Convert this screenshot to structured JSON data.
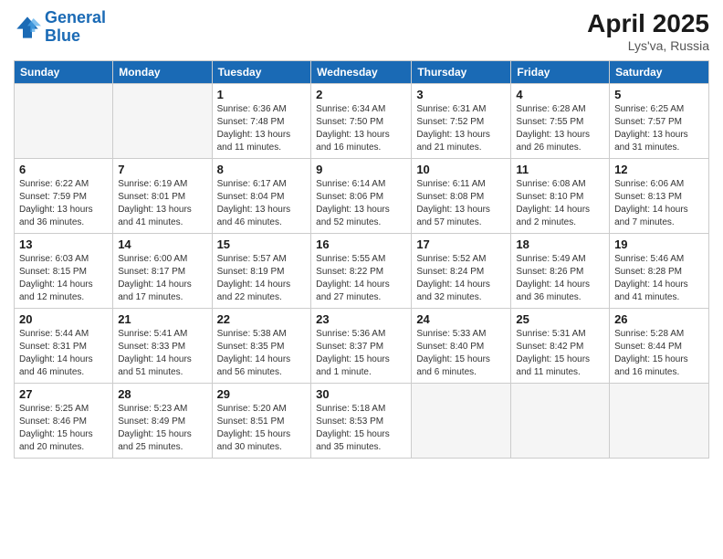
{
  "logo": {
    "line1": "General",
    "line2": "Blue"
  },
  "title": "April 2025",
  "subtitle": "Lys'va, Russia",
  "days_of_week": [
    "Sunday",
    "Monday",
    "Tuesday",
    "Wednesday",
    "Thursday",
    "Friday",
    "Saturday"
  ],
  "weeks": [
    [
      {
        "day": "",
        "empty": true
      },
      {
        "day": "",
        "empty": true
      },
      {
        "day": "1",
        "sunrise": "Sunrise: 6:36 AM",
        "sunset": "Sunset: 7:48 PM",
        "daylight": "Daylight: 13 hours and 11 minutes."
      },
      {
        "day": "2",
        "sunrise": "Sunrise: 6:34 AM",
        "sunset": "Sunset: 7:50 PM",
        "daylight": "Daylight: 13 hours and 16 minutes."
      },
      {
        "day": "3",
        "sunrise": "Sunrise: 6:31 AM",
        "sunset": "Sunset: 7:52 PM",
        "daylight": "Daylight: 13 hours and 21 minutes."
      },
      {
        "day": "4",
        "sunrise": "Sunrise: 6:28 AM",
        "sunset": "Sunset: 7:55 PM",
        "daylight": "Daylight: 13 hours and 26 minutes."
      },
      {
        "day": "5",
        "sunrise": "Sunrise: 6:25 AM",
        "sunset": "Sunset: 7:57 PM",
        "daylight": "Daylight: 13 hours and 31 minutes."
      }
    ],
    [
      {
        "day": "6",
        "sunrise": "Sunrise: 6:22 AM",
        "sunset": "Sunset: 7:59 PM",
        "daylight": "Daylight: 13 hours and 36 minutes."
      },
      {
        "day": "7",
        "sunrise": "Sunrise: 6:19 AM",
        "sunset": "Sunset: 8:01 PM",
        "daylight": "Daylight: 13 hours and 41 minutes."
      },
      {
        "day": "8",
        "sunrise": "Sunrise: 6:17 AM",
        "sunset": "Sunset: 8:04 PM",
        "daylight": "Daylight: 13 hours and 46 minutes."
      },
      {
        "day": "9",
        "sunrise": "Sunrise: 6:14 AM",
        "sunset": "Sunset: 8:06 PM",
        "daylight": "Daylight: 13 hours and 52 minutes."
      },
      {
        "day": "10",
        "sunrise": "Sunrise: 6:11 AM",
        "sunset": "Sunset: 8:08 PM",
        "daylight": "Daylight: 13 hours and 57 minutes."
      },
      {
        "day": "11",
        "sunrise": "Sunrise: 6:08 AM",
        "sunset": "Sunset: 8:10 PM",
        "daylight": "Daylight: 14 hours and 2 minutes."
      },
      {
        "day": "12",
        "sunrise": "Sunrise: 6:06 AM",
        "sunset": "Sunset: 8:13 PM",
        "daylight": "Daylight: 14 hours and 7 minutes."
      }
    ],
    [
      {
        "day": "13",
        "sunrise": "Sunrise: 6:03 AM",
        "sunset": "Sunset: 8:15 PM",
        "daylight": "Daylight: 14 hours and 12 minutes."
      },
      {
        "day": "14",
        "sunrise": "Sunrise: 6:00 AM",
        "sunset": "Sunset: 8:17 PM",
        "daylight": "Daylight: 14 hours and 17 minutes."
      },
      {
        "day": "15",
        "sunrise": "Sunrise: 5:57 AM",
        "sunset": "Sunset: 8:19 PM",
        "daylight": "Daylight: 14 hours and 22 minutes."
      },
      {
        "day": "16",
        "sunrise": "Sunrise: 5:55 AM",
        "sunset": "Sunset: 8:22 PM",
        "daylight": "Daylight: 14 hours and 27 minutes."
      },
      {
        "day": "17",
        "sunrise": "Sunrise: 5:52 AM",
        "sunset": "Sunset: 8:24 PM",
        "daylight": "Daylight: 14 hours and 32 minutes."
      },
      {
        "day": "18",
        "sunrise": "Sunrise: 5:49 AM",
        "sunset": "Sunset: 8:26 PM",
        "daylight": "Daylight: 14 hours and 36 minutes."
      },
      {
        "day": "19",
        "sunrise": "Sunrise: 5:46 AM",
        "sunset": "Sunset: 8:28 PM",
        "daylight": "Daylight: 14 hours and 41 minutes."
      }
    ],
    [
      {
        "day": "20",
        "sunrise": "Sunrise: 5:44 AM",
        "sunset": "Sunset: 8:31 PM",
        "daylight": "Daylight: 14 hours and 46 minutes."
      },
      {
        "day": "21",
        "sunrise": "Sunrise: 5:41 AM",
        "sunset": "Sunset: 8:33 PM",
        "daylight": "Daylight: 14 hours and 51 minutes."
      },
      {
        "day": "22",
        "sunrise": "Sunrise: 5:38 AM",
        "sunset": "Sunset: 8:35 PM",
        "daylight": "Daylight: 14 hours and 56 minutes."
      },
      {
        "day": "23",
        "sunrise": "Sunrise: 5:36 AM",
        "sunset": "Sunset: 8:37 PM",
        "daylight": "Daylight: 15 hours and 1 minute."
      },
      {
        "day": "24",
        "sunrise": "Sunrise: 5:33 AM",
        "sunset": "Sunset: 8:40 PM",
        "daylight": "Daylight: 15 hours and 6 minutes."
      },
      {
        "day": "25",
        "sunrise": "Sunrise: 5:31 AM",
        "sunset": "Sunset: 8:42 PM",
        "daylight": "Daylight: 15 hours and 11 minutes."
      },
      {
        "day": "26",
        "sunrise": "Sunrise: 5:28 AM",
        "sunset": "Sunset: 8:44 PM",
        "daylight": "Daylight: 15 hours and 16 minutes."
      }
    ],
    [
      {
        "day": "27",
        "sunrise": "Sunrise: 5:25 AM",
        "sunset": "Sunset: 8:46 PM",
        "daylight": "Daylight: 15 hours and 20 minutes."
      },
      {
        "day": "28",
        "sunrise": "Sunrise: 5:23 AM",
        "sunset": "Sunset: 8:49 PM",
        "daylight": "Daylight: 15 hours and 25 minutes."
      },
      {
        "day": "29",
        "sunrise": "Sunrise: 5:20 AM",
        "sunset": "Sunset: 8:51 PM",
        "daylight": "Daylight: 15 hours and 30 minutes."
      },
      {
        "day": "30",
        "sunrise": "Sunrise: 5:18 AM",
        "sunset": "Sunset: 8:53 PM",
        "daylight": "Daylight: 15 hours and 35 minutes."
      },
      {
        "day": "",
        "empty": true
      },
      {
        "day": "",
        "empty": true
      },
      {
        "day": "",
        "empty": true
      }
    ]
  ]
}
